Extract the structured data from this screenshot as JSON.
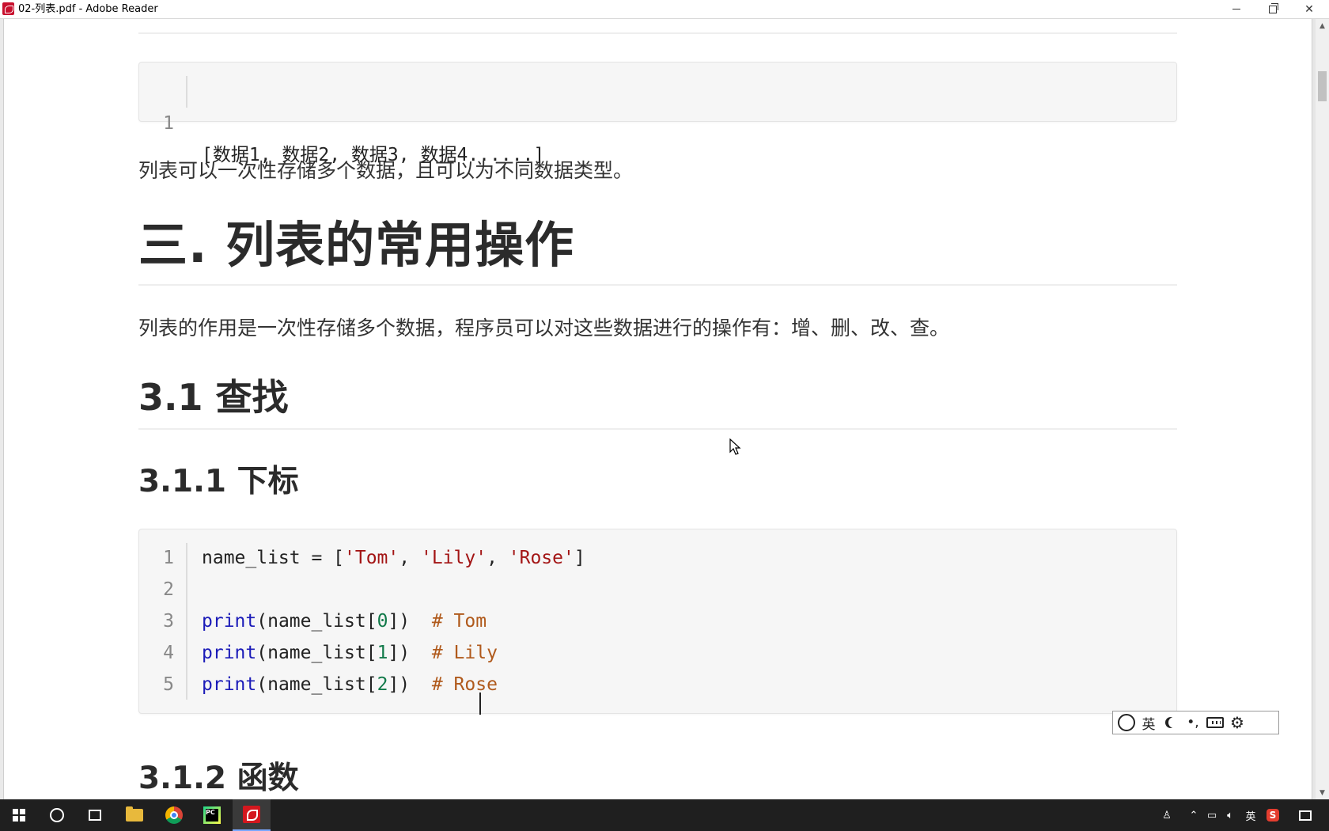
{
  "window": {
    "title": "02-列表.pdf - Adobe Reader"
  },
  "document": {
    "code_block_1": {
      "lines": [
        {
          "num": "1",
          "text": "[数据1, 数据2, 数据3, 数据4......]"
        }
      ]
    },
    "para_1": "列表可以一次性存储多个数据，且可以为不同数据类型。",
    "heading_1": "三. 列表的常用操作",
    "para_2": "列表的作用是一次性存储多个数据，程序员可以对这些数据进行的操作有：增、删、改、查。",
    "heading_2": "3.1 查找",
    "heading_3": "3.1.1 下标",
    "code_block_2": {
      "lines": [
        {
          "num": "1",
          "parts": [
            [
              "plain",
              "name_list = ["
            ],
            [
              "str",
              "'Tom'"
            ],
            [
              "plain",
              ", "
            ],
            [
              "str",
              "'Lily'"
            ],
            [
              "plain",
              ", "
            ],
            [
              "str",
              "'Rose'"
            ],
            [
              "plain",
              "]"
            ]
          ]
        },
        {
          "num": "2",
          "parts": []
        },
        {
          "num": "3",
          "parts": [
            [
              "kw",
              "print"
            ],
            [
              "plain",
              "(name_list["
            ],
            [
              "num",
              "0"
            ],
            [
              "plain",
              "])  "
            ],
            [
              "cmt",
              "# Tom"
            ]
          ]
        },
        {
          "num": "4",
          "parts": [
            [
              "kw",
              "print"
            ],
            [
              "plain",
              "(name_list["
            ],
            [
              "num",
              "1"
            ],
            [
              "plain",
              "])  "
            ],
            [
              "cmt",
              "# Lily"
            ]
          ]
        },
        {
          "num": "5",
          "parts": [
            [
              "kw",
              "print"
            ],
            [
              "plain",
              "(name_list["
            ],
            [
              "num",
              "2"
            ],
            [
              "plain",
              "])  "
            ],
            [
              "cmt",
              "# Rose"
            ]
          ]
        }
      ]
    },
    "heading_4": "3.1.2 函数"
  },
  "ime_toolbar": {
    "mode_label": "英",
    "icons": [
      "ime-logo-icon",
      "moon-icon",
      "punctuation-icon",
      "keyboard-icon",
      "gear-icon"
    ]
  },
  "taskbar": {
    "apps": [
      "windows-start-icon",
      "search-icon",
      "task-view-icon",
      "file-explorer-icon",
      "chrome-icon",
      "pycharm-icon",
      "acrobat-icon"
    ],
    "tray": {
      "language": "英"
    }
  }
}
